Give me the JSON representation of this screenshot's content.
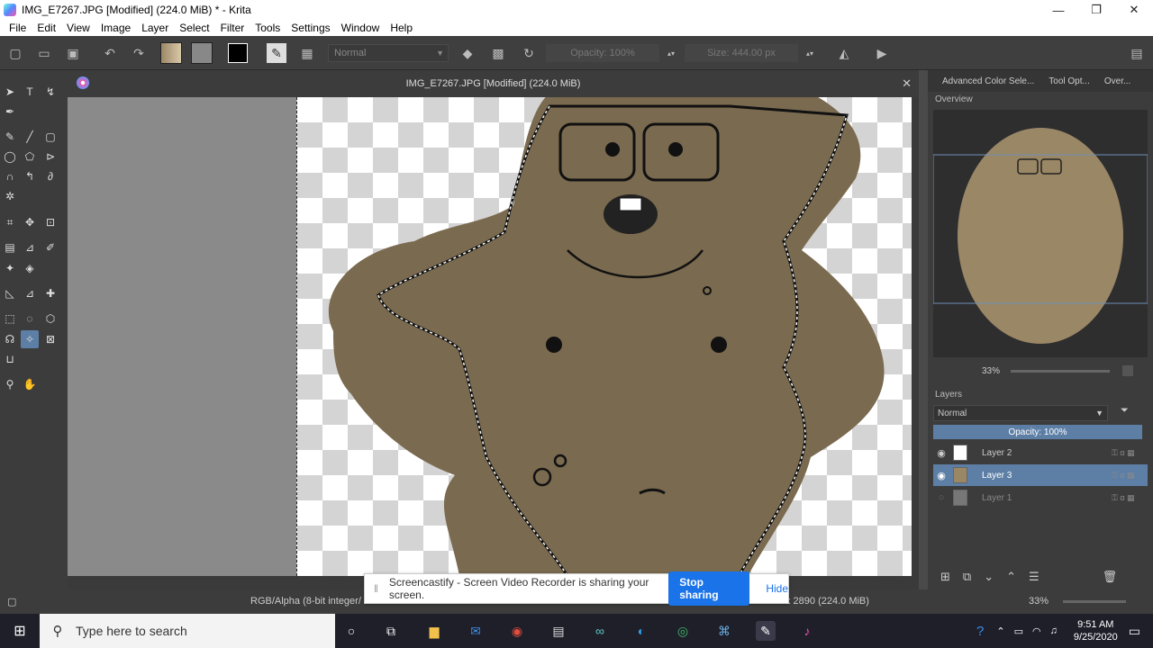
{
  "window": {
    "title": "IMG_E7267.JPG [Modified]  (224.0 MiB) * - Krita",
    "minimize": "—",
    "maximize": "❐",
    "close": "✕"
  },
  "menu": [
    "File",
    "Edit",
    "View",
    "Image",
    "Layer",
    "Select",
    "Filter",
    "Tools",
    "Settings",
    "Window",
    "Help"
  ],
  "toolbar": {
    "blend_mode": "Normal",
    "opacity_label": "Opacity: 100%",
    "size_label": "Size: 444.00 px"
  },
  "document": {
    "tab_title": "IMG_E7267.JPG [Modified]  (224.0 MiB)"
  },
  "dock": {
    "tabs": [
      "Advanced Color Sele...",
      "Tool Opt...",
      "Over..."
    ],
    "overview_title": "Overview",
    "overview_zoom": "33%",
    "layers_title": "Layers",
    "layers_blend_mode": "Normal",
    "layers_opacity": "Opacity:  100%",
    "layers": [
      {
        "name": "Layer 2",
        "visible": true,
        "selected": false
      },
      {
        "name": "Layer 3",
        "visible": true,
        "selected": true
      },
      {
        "name": "Layer 1",
        "visible": false,
        "selected": false
      }
    ]
  },
  "status": {
    "color_model": "RGB/Alpha (8-bit integer/",
    "dimensions": "x 2890 (224.0 MiB)",
    "zoom": "33%"
  },
  "screencastify": {
    "message": "Screencastify - Screen Video Recorder is sharing your screen.",
    "stop_label": "Stop sharing",
    "hide_label": "Hide"
  },
  "taskbar": {
    "search_placeholder": "Type here to search",
    "time": "9:51 AM",
    "date": "9/25/2020"
  },
  "colors": {
    "accent": "#5d7fa6",
    "figure_fill": "#7a6a4f",
    "foreground_swatch": "#000000"
  }
}
